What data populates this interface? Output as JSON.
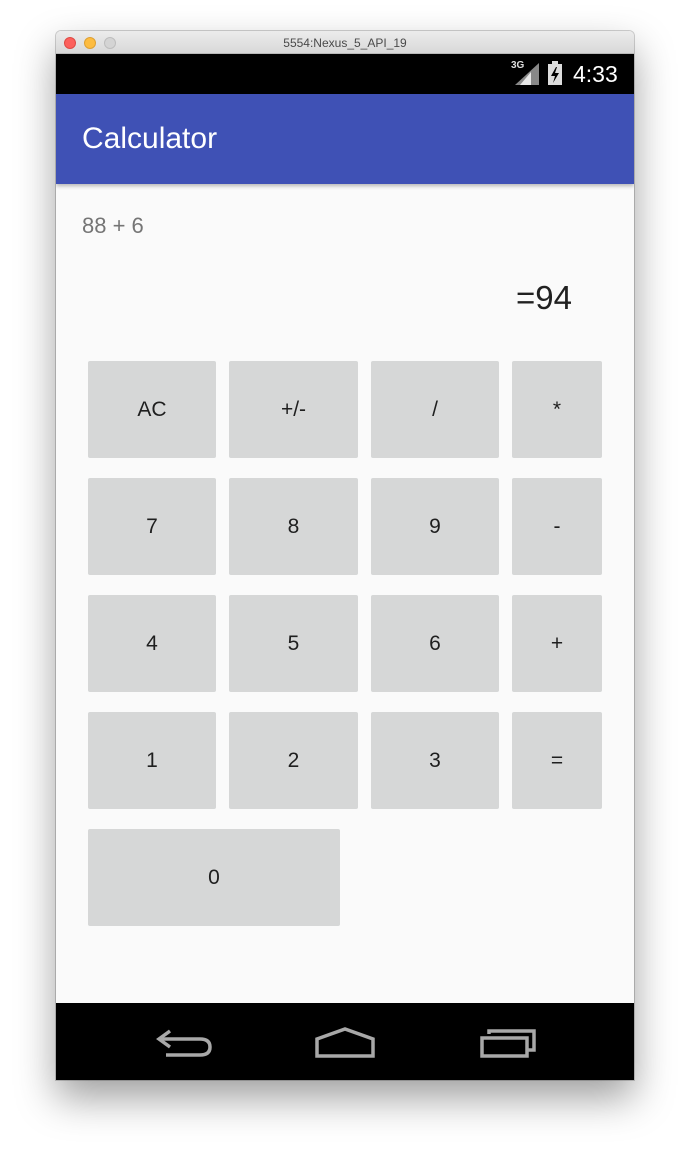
{
  "window": {
    "title": "5554:Nexus_5_API_19"
  },
  "status_bar": {
    "network": "3G",
    "time": "4:33"
  },
  "app_bar": {
    "title": "Calculator"
  },
  "display": {
    "expression": "88 + 6",
    "result": "=94"
  },
  "keys": {
    "ac": "AC",
    "sign": "+/-",
    "divide": "/",
    "multiply": "*",
    "seven": "7",
    "eight": "8",
    "nine": "9",
    "minus": "-",
    "four": "4",
    "five": "5",
    "six": "6",
    "plus": "+",
    "one": "1",
    "two": "2",
    "three": "3",
    "equals": "=",
    "zero": "0"
  },
  "colors": {
    "app_bar": "#3f51b5",
    "key_background": "#d6d7d7",
    "screen_background": "#fafafa",
    "system_bars": "#000000"
  },
  "icons": [
    "signal-icon",
    "battery-charging-icon",
    "back-icon",
    "home-icon",
    "recents-icon"
  ]
}
